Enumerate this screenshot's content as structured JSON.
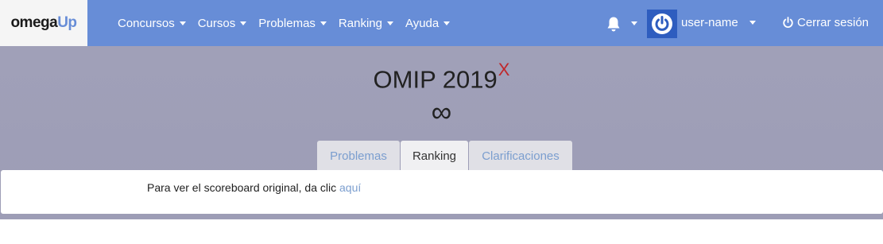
{
  "brand": {
    "part1": "omega",
    "part2": "Up"
  },
  "nav": {
    "items": [
      {
        "label": "Concursos"
      },
      {
        "label": "Cursos"
      },
      {
        "label": "Problemas"
      },
      {
        "label": "Ranking"
      },
      {
        "label": "Ayuda"
      }
    ],
    "user_name": "user-name",
    "logout_label": "Cerrar sesión"
  },
  "contest": {
    "title": "OMIP 2019",
    "title_mark": "X",
    "time_remaining": "∞"
  },
  "tabs": [
    {
      "label": "Problemas",
      "active": false
    },
    {
      "label": "Ranking",
      "active": true
    },
    {
      "label": "Clarificaciones",
      "active": false
    }
  ],
  "notice": {
    "text": "Para ver el scoreboard original, da clic ",
    "link_label": "aquí"
  },
  "colors": {
    "navbar": "#678dd7",
    "header_bg": "#a0a0b8",
    "link": "#7b9ecf",
    "title_mark": "#c0282b"
  }
}
